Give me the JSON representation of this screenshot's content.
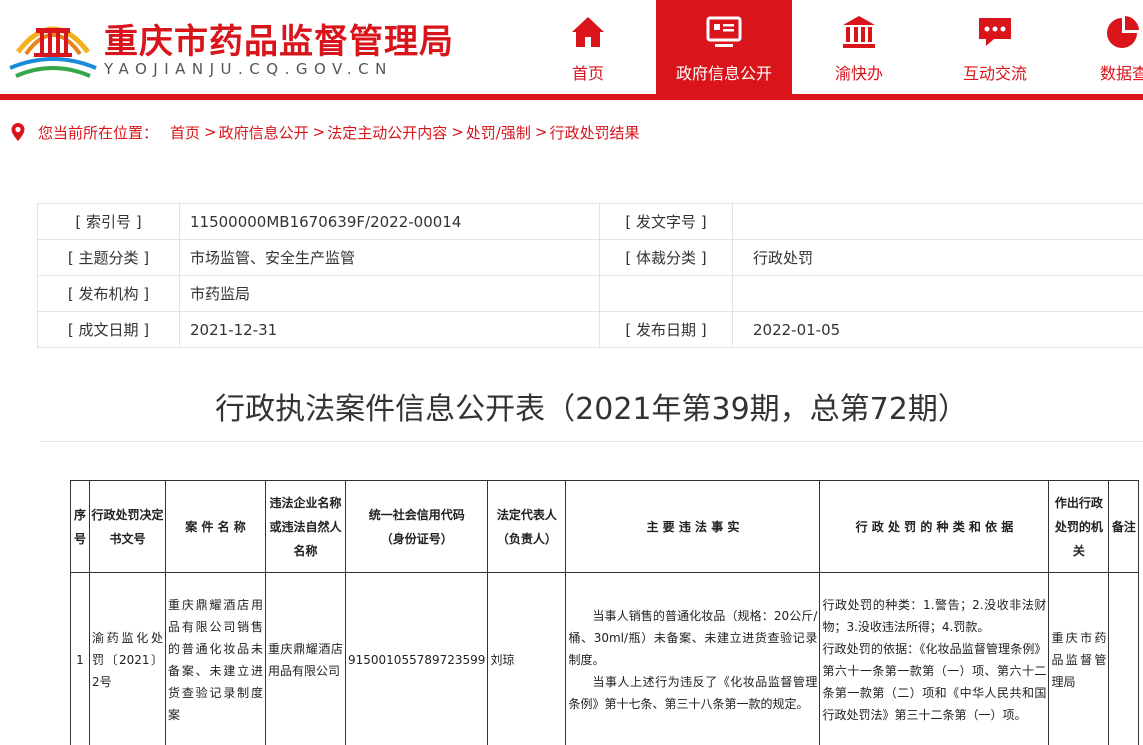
{
  "header": {
    "title": "重庆市药品监督管理局",
    "domain": "YAOJIANJU.CQ.GOV.CN",
    "colors": {
      "brand": "#d9141b",
      "text": "#333333"
    }
  },
  "nav": {
    "items": [
      {
        "label": "首页",
        "icon": "home-icon"
      },
      {
        "label": "政府信息公开",
        "icon": "monitor-icon",
        "active": true
      },
      {
        "label": "渝快办",
        "icon": "government-building-icon"
      },
      {
        "label": "互动交流",
        "icon": "chat-icon"
      },
      {
        "label": "数据查",
        "icon": "pie-chart-icon"
      }
    ]
  },
  "breadcrumb": {
    "label": "您当前所在位置：",
    "items": [
      "首页",
      "政府信息公开",
      "法定主动公开内容",
      "处罚/强制",
      "行政处罚结果"
    ],
    "separator": ">"
  },
  "info": {
    "index_label": "[ 索引号 ]",
    "index_value": "11500000MB1670639F/2022-00014",
    "docno_label": "[ 发文字号 ]",
    "docno_value": "",
    "topic_label": "[ 主题分类 ]",
    "topic_value": "市场监管、安全生产监管",
    "genre_label": "[ 体裁分类 ]",
    "genre_value": "行政处罚",
    "org_label": "[ 发布机构 ]",
    "org_value": "市药监局",
    "date_label": "[ 成文日期 ]",
    "date_value": "2021-12-31",
    "pub_label": "[ 发布日期 ]",
    "pub_value": "2022-01-05"
  },
  "doc_title": "行政执法案件信息公开表（2021年第39期，总第72期）",
  "case_table": {
    "headers": {
      "seq": "序号",
      "decision_no": "行政处罚决定书文号",
      "case_name": "案 件 名 称",
      "party": "违法企业名称或违法自然人名称",
      "credit_code": "统一社会信用代码",
      "credit_code_sub": "（身份证号）",
      "legal_rep": "法定代表人",
      "legal_rep_sub": "（负责人）",
      "facts": "主 要 违 法 事 实",
      "penalty": "行 政 处 罚 的 种 类 和 依 据",
      "authority": "作出行政处罚的机关",
      "remark": "备注"
    },
    "rows": [
      {
        "seq": "1",
        "decision_no": "渝药监化处罚〔2021〕2号",
        "case_name": "重庆鼎耀酒店用品有限公司销售的普通化妆品未备案、未建立进货查验记录制度案",
        "party": "重庆鼎耀酒店用品有限公司",
        "credit_code": "915001055789723599",
        "legal_rep": "刘琼",
        "facts_1": "当事人销售的普通化妆品（规格：20公斤/桶、30ml/瓶）未备案、未建立进货查验记录制度。",
        "facts_2": "当事人上述行为违反了《化妆品监督管理条例》第十七条、第三十八条第一款的规定。",
        "penalty_1": "行政处罚的种类：1.警告；2.没收非法财物；3.没收违法所得；4.罚款。",
        "penalty_2": "行政处罚的依据：《化妆品监督管理条例》第六十一条第一款第（一）项、第六十二条第一款第（二）项和《中华人民共和国行政处罚法》第三十二条第（一）项。",
        "authority": "重庆市药品监督管理局",
        "remark": ""
      }
    ]
  }
}
